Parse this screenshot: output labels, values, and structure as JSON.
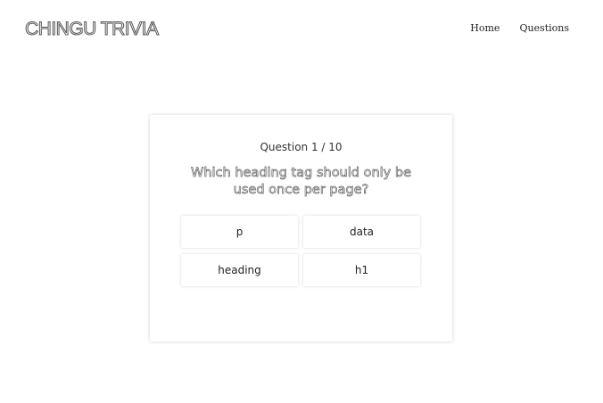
{
  "header": {
    "brand": "CHINGU TRIVIA",
    "nav": [
      {
        "label": "Home"
      },
      {
        "label": "Questions"
      }
    ]
  },
  "quiz": {
    "counter": "Question 1 / 10",
    "question": "Which heading tag should only be used once per page?",
    "answers": [
      {
        "label": "p"
      },
      {
        "label": "data"
      },
      {
        "label": "heading"
      },
      {
        "label": "h1"
      }
    ]
  }
}
